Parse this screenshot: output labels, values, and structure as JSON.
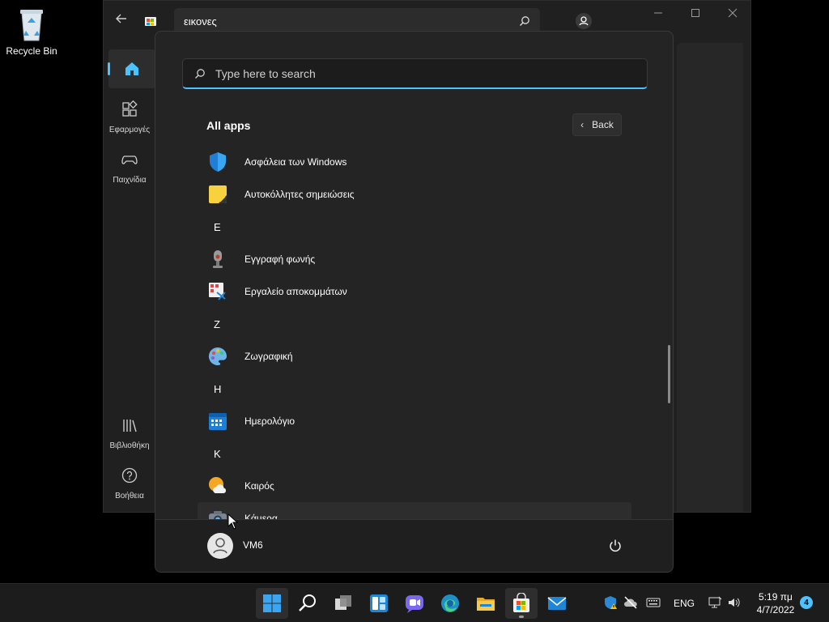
{
  "desktop": {
    "recycle_bin_label": "Recycle Bin"
  },
  "store_window": {
    "search_query": "εικονες",
    "nav": [
      {
        "label": "",
        "icon": "home-icon",
        "selected": true
      },
      {
        "label": "Εφαρμογές",
        "icon": "apps-icon"
      },
      {
        "label": "Παιχνίδια",
        "icon": "gamepad-icon"
      },
      {
        "label": "Βιβλιοθήκη",
        "icon": "library-icon"
      },
      {
        "label": "Βοήθεια",
        "icon": "help-icon"
      }
    ]
  },
  "start_menu": {
    "search_placeholder": "Type here to search",
    "all_apps_title": "All apps",
    "back_label": "Back",
    "items": [
      {
        "type": "app",
        "name": "Ασφάλεια των Windows",
        "icon": "windows-security-icon"
      },
      {
        "type": "app",
        "name": "Αυτοκόλλητες σημειώσεις",
        "icon": "sticky-notes-icon"
      },
      {
        "type": "letter",
        "name": "Ε"
      },
      {
        "type": "app",
        "name": "Εγγραφή φωνής",
        "icon": "voice-recorder-icon"
      },
      {
        "type": "app",
        "name": "Εργαλείο αποκομμάτων",
        "icon": "snipping-tool-icon"
      },
      {
        "type": "letter",
        "name": "Ζ"
      },
      {
        "type": "app",
        "name": "Ζωγραφική",
        "icon": "paint-icon"
      },
      {
        "type": "letter",
        "name": "Η"
      },
      {
        "type": "app",
        "name": "Ημερολόγιο",
        "icon": "calendar-icon"
      },
      {
        "type": "letter",
        "name": "Κ"
      },
      {
        "type": "app",
        "name": "Καιρός",
        "icon": "weather-icon"
      },
      {
        "type": "app",
        "name": "Κάμερα",
        "icon": "camera-icon",
        "hover": true
      }
    ],
    "user_name": "VM6"
  },
  "taskbar": {
    "apps": [
      "start-icon",
      "search-icon",
      "task-view-icon",
      "widgets-icon",
      "chat-icon",
      "edge-icon",
      "file-explorer-icon",
      "store-icon",
      "mail-icon"
    ],
    "language": "ENG",
    "time": "5:19 πμ",
    "date": "4/7/2022",
    "notification_count": "4"
  }
}
